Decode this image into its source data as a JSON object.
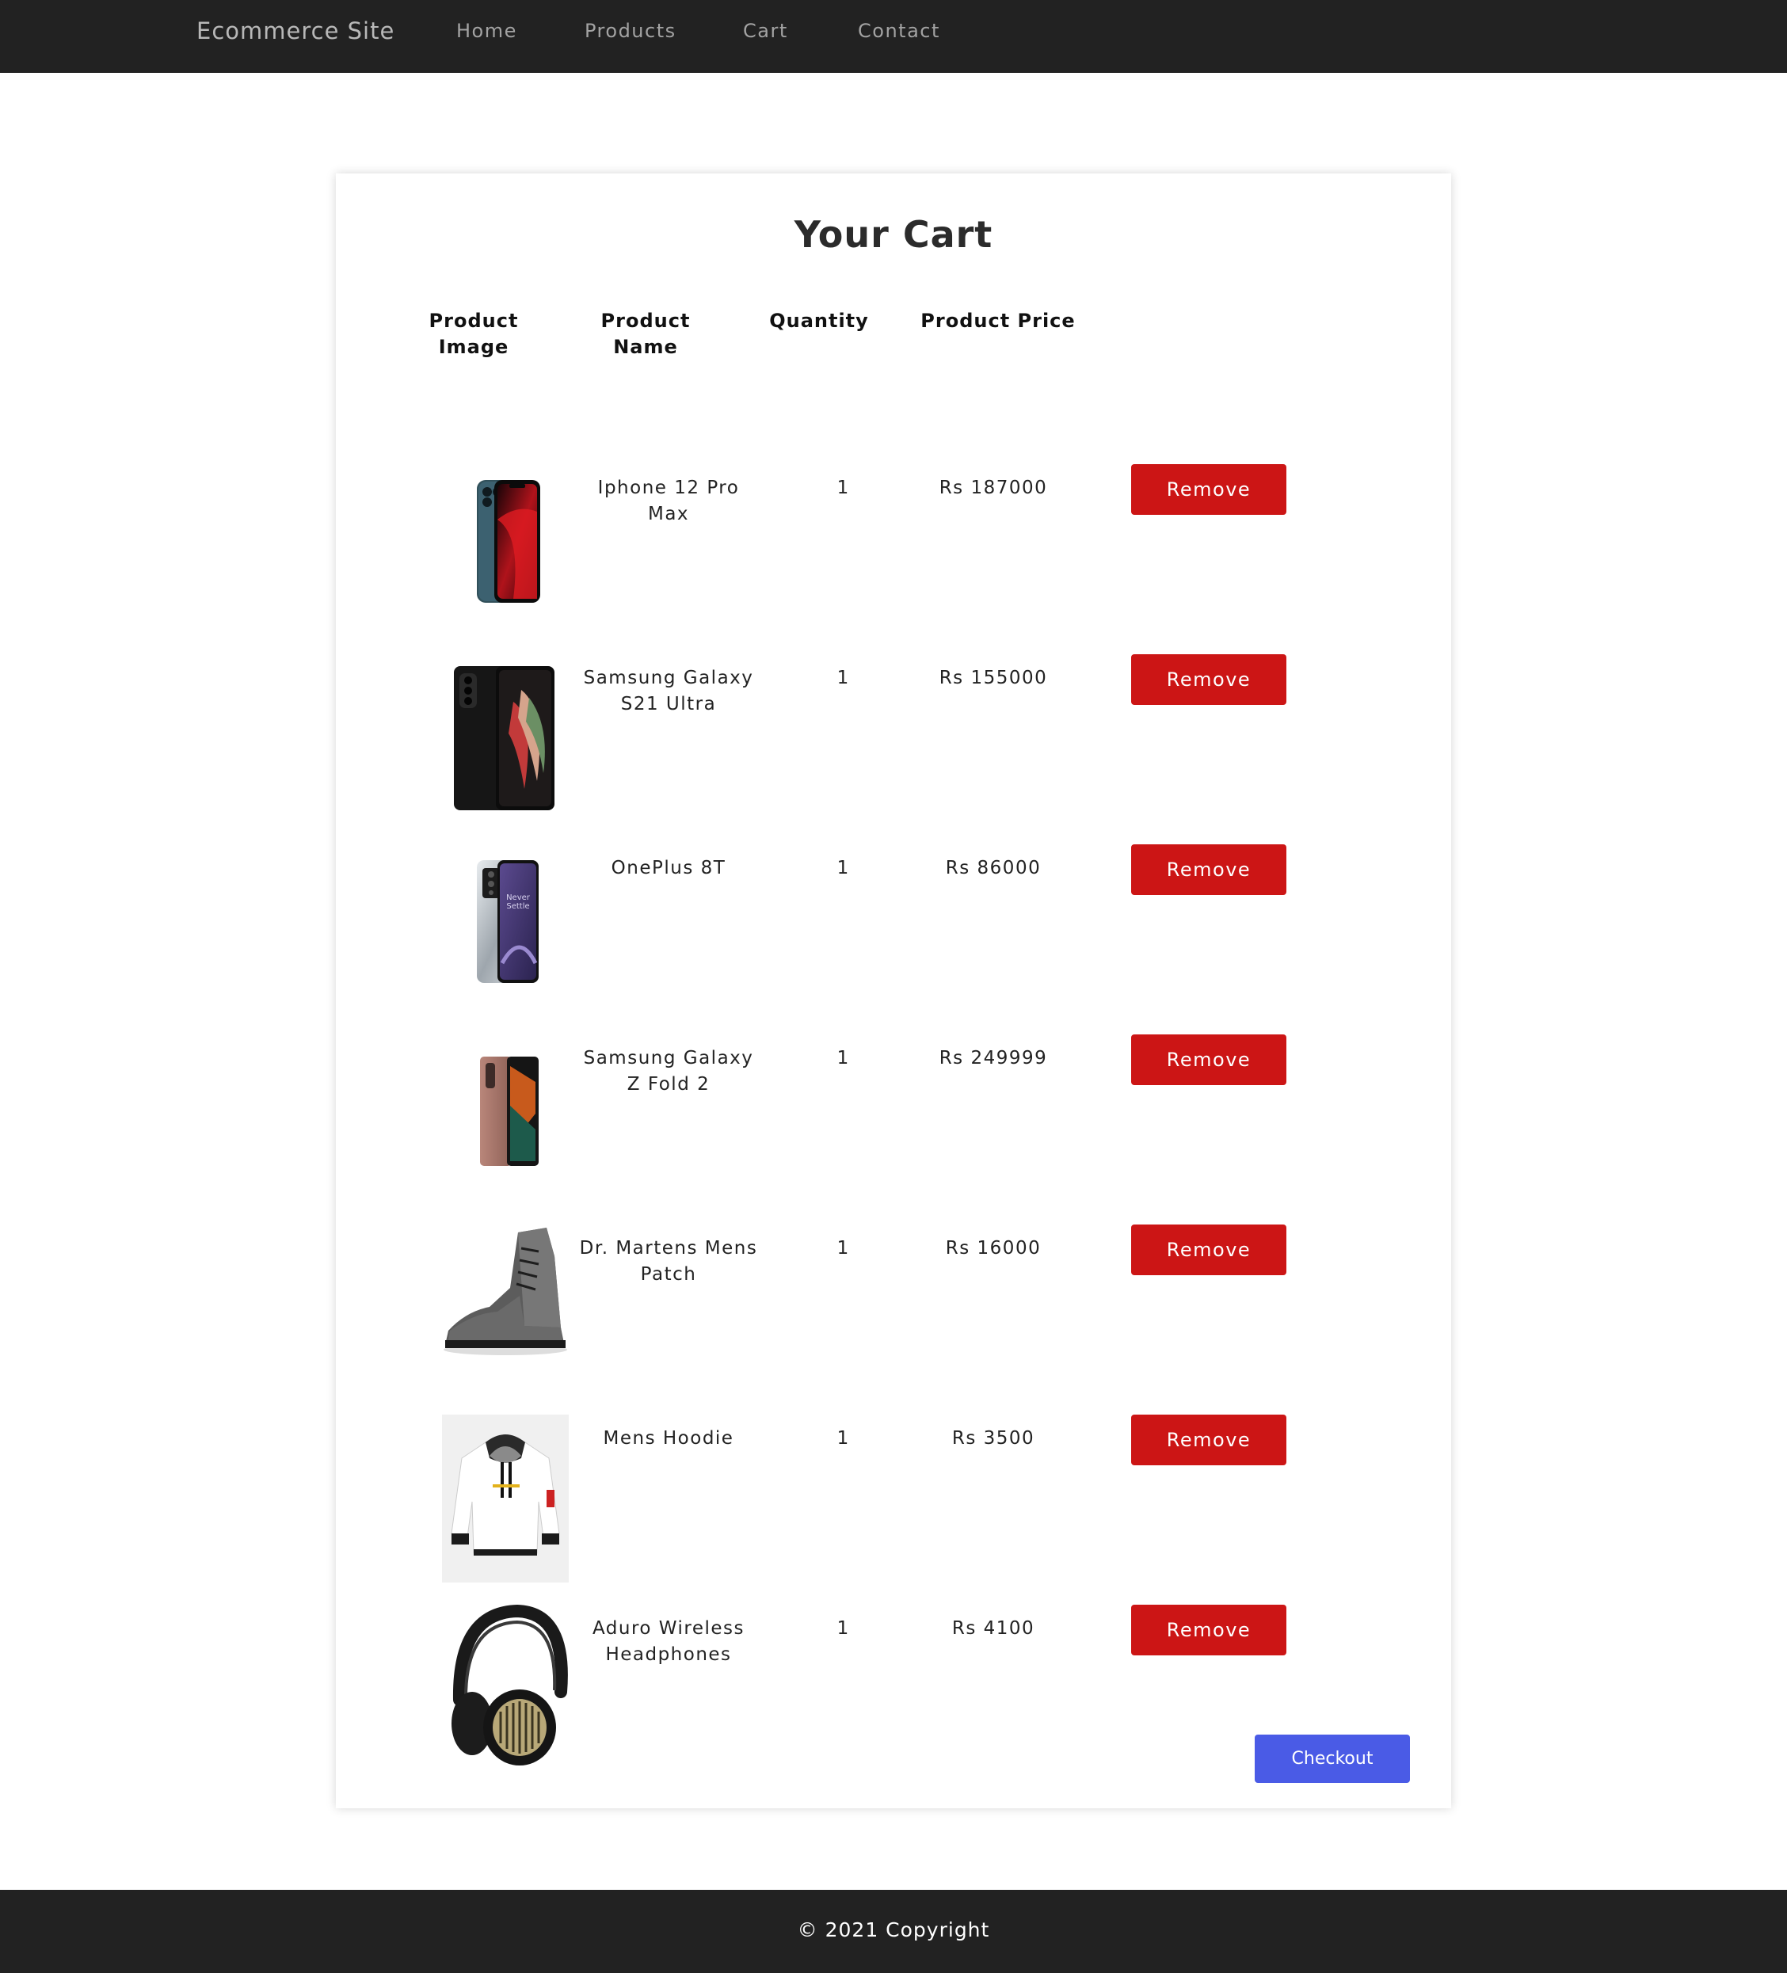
{
  "nav": {
    "brand": "Ecommerce Site",
    "links": [
      "Home",
      "Products",
      "Cart",
      "Contact"
    ]
  },
  "cart": {
    "title": "Your Cart",
    "headers": {
      "image": "Product Image",
      "name": "Product Name",
      "quantity": "Quantity",
      "price": "Product Price"
    },
    "remove_label": "Remove",
    "checkout_label": "Checkout",
    "items": [
      {
        "name": "Iphone 12 Pro Max",
        "quantity": "1",
        "price": "Rs 187000",
        "icon": "iphone-12-pro-max-image"
      },
      {
        "name": "Samsung Galaxy S21 Ultra",
        "quantity": "1",
        "price": "Rs 155000",
        "icon": "galaxy-s21-ultra-image"
      },
      {
        "name": "OnePlus 8T",
        "quantity": "1",
        "price": "Rs 86000",
        "icon": "oneplus-8t-image"
      },
      {
        "name": "Samsung Galaxy Z Fold 2",
        "quantity": "1",
        "price": "Rs 249999",
        "icon": "galaxy-z-fold-2-image"
      },
      {
        "name": "Dr. Martens Mens Patch",
        "quantity": "1",
        "price": "Rs 16000",
        "icon": "boot-image"
      },
      {
        "name": "Mens Hoodie",
        "quantity": "1",
        "price": "Rs 3500",
        "icon": "hoodie-image"
      },
      {
        "name": "Aduro Wireless Headphones",
        "quantity": "1",
        "price": "Rs 4100",
        "icon": "headphones-image"
      }
    ]
  },
  "footer": {
    "text": "© 2021 Copyright"
  },
  "colors": {
    "nav_bg": "#222222",
    "remove_button": "#cc1515",
    "checkout_button": "#4a5be6",
    "footer_bg": "#222222"
  }
}
